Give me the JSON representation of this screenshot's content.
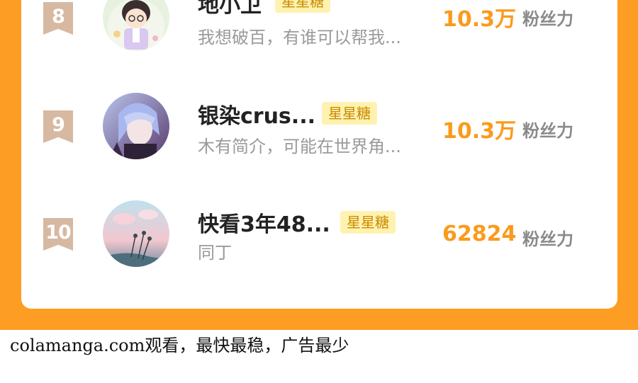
{
  "ranking": {
    "entries": [
      {
        "rank": "8",
        "name": "地小卫",
        "badge": "星星糖",
        "bio": "我想破百，有谁可以帮我...",
        "fans_value": "10.3万",
        "fans_label": "粉丝力",
        "avatar": "avatar-cartoon-boy-image"
      },
      {
        "rank": "9",
        "name": "银染crus...",
        "badge": "星星糖",
        "bio": "木有简介，可能在世界角...",
        "fans_value": "10.3万",
        "fans_label": "粉丝力",
        "avatar": "avatar-anime-boy-image"
      },
      {
        "rank": "10",
        "name": "快看3年48...",
        "badge": "星星糖",
        "bio": "同丁",
        "fans_value": "62824",
        "fans_label": "粉丝力",
        "avatar": "avatar-landscape-image"
      }
    ]
  },
  "footer": {
    "text": "colamanga.com观看，最快最稳，广告最少"
  },
  "colors": {
    "frame": "#fd9d24",
    "rank_ribbon": "#d7b8a1",
    "badge_bg": "#fff2b0",
    "fans_value": "#fb9a1c"
  }
}
